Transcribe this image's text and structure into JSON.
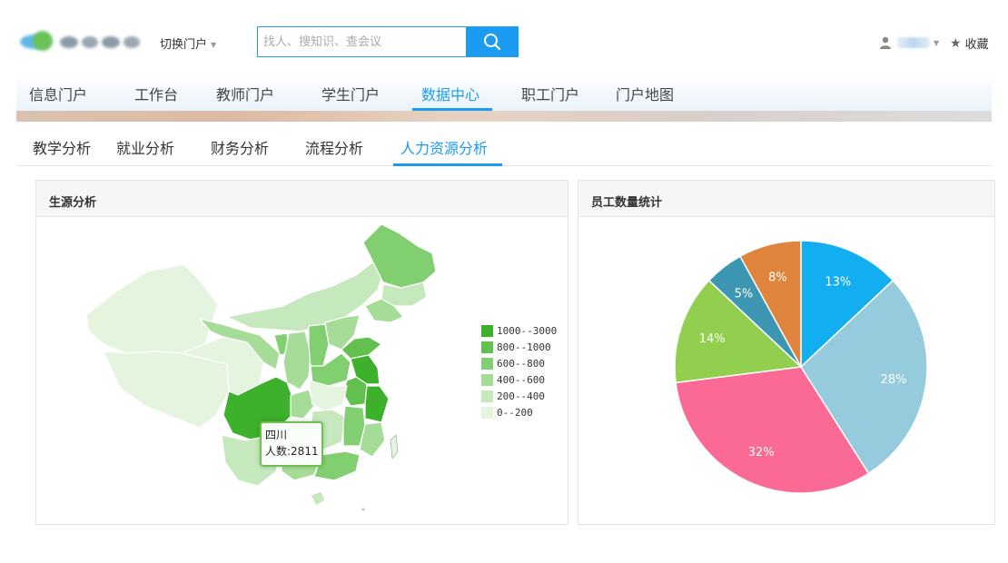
{
  "header": {
    "switch_portal": "切换门户",
    "search_placeholder": "找人、搜知识、查会议",
    "favorite": "收藏"
  },
  "main_nav": {
    "items": [
      "信息门户",
      "工作台",
      "教师门户",
      "学生门户",
      "数据中心",
      "职工门户",
      "门户地图"
    ],
    "active": "数据中心"
  },
  "sub_nav": {
    "items": [
      "教学分析",
      "就业分析",
      "财务分析",
      "流程分析",
      "人力资源分析"
    ],
    "active": "人力资源分析"
  },
  "map_panel": {
    "title": "生源分析",
    "legend": [
      "1000--3000",
      "800--1000",
      "600--800",
      "400--600",
      "200--400",
      "0--200"
    ],
    "legend_colors": [
      "#3db02c",
      "#61c04e",
      "#82cf72",
      "#a5dc98",
      "#c5e8bc",
      "#e4f4df"
    ],
    "tooltip": {
      "province": "四川",
      "count": "人数:2811"
    }
  },
  "pie_panel": {
    "title": "员工数量统计"
  },
  "chart_data": {
    "type": "pie",
    "title": "员工数量统计",
    "labels": [
      "13%",
      "28%",
      "32%",
      "14%",
      "5%",
      "8%"
    ],
    "values": [
      13,
      28,
      32,
      14,
      5,
      8
    ],
    "colors": [
      "#12aef0",
      "#95cbdd",
      "#fb6a95",
      "#93cf4e",
      "#3e97b2",
      "#de843d"
    ]
  },
  "colors": {
    "accent": "#1b9cf2"
  }
}
